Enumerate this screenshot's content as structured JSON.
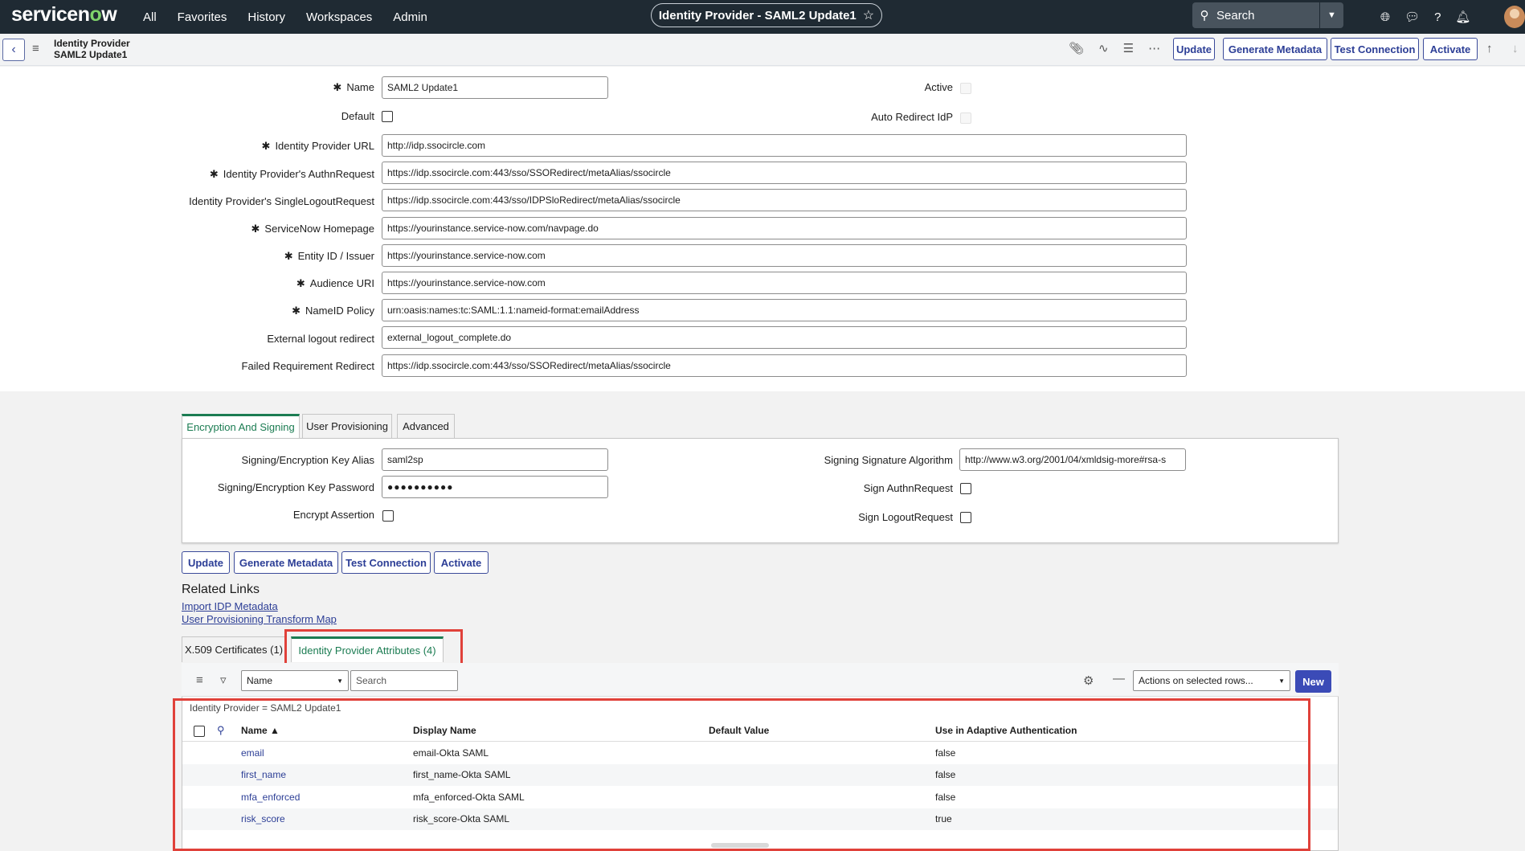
{
  "nav": {
    "logo": "servicenow",
    "links": [
      "All",
      "Favorites",
      "History",
      "Workspaces",
      "Admin"
    ],
    "context_title": "Identity Provider - SAML2 Update1",
    "search_placeholder": "Search"
  },
  "form_header": {
    "title_line1": "Identity Provider",
    "title_line2": "SAML2 Update1",
    "buttons": {
      "update": "Update",
      "generate_metadata": "Generate Metadata",
      "test_connection": "Test Connection",
      "activate": "Activate"
    }
  },
  "fields": {
    "name": {
      "label": "Name",
      "value": "SAML2 Update1"
    },
    "default": {
      "label": "Default"
    },
    "active": {
      "label": "Active"
    },
    "auto_redirect": {
      "label": "Auto Redirect IdP"
    },
    "idp_url": {
      "label": "Identity Provider URL",
      "value": "http://idp.ssocircle.com"
    },
    "authn_request": {
      "label": "Identity Provider's AuthnRequest",
      "value": "https://idp.ssocircle.com:443/sso/SSORedirect/metaAlias/ssocircle"
    },
    "single_logout": {
      "label": "Identity Provider's SingleLogoutRequest",
      "value": "https://idp.ssocircle.com:443/sso/IDPSloRedirect/metaAlias/ssocircle"
    },
    "homepage": {
      "label": "ServiceNow Homepage",
      "value": "https://yourinstance.service-now.com/navpage.do"
    },
    "entity_id": {
      "label": "Entity ID / Issuer",
      "value": "https://yourinstance.service-now.com"
    },
    "audience_uri": {
      "label": "Audience URI",
      "value": "https://yourinstance.service-now.com"
    },
    "nameid_policy": {
      "label": "NameID Policy",
      "value": "urn:oasis:names:tc:SAML:1.1:nameid-format:emailAddress"
    },
    "external_logout": {
      "label": "External logout redirect",
      "value": "external_logout_complete.do"
    },
    "failed_redirect": {
      "label": "Failed Requirement Redirect",
      "value": "https://idp.ssocircle.com:443/sso/SSORedirect/metaAlias/ssocircle"
    }
  },
  "tabs": {
    "items": [
      "Encryption And Signing",
      "User Provisioning",
      "Advanced"
    ],
    "encryption": {
      "key_alias": {
        "label": "Signing/Encryption Key Alias",
        "value": "saml2sp"
      },
      "key_password": {
        "label": "Signing/Encryption Key Password",
        "value": "●●●●●●●●●●"
      },
      "encrypt_assertion": {
        "label": "Encrypt Assertion"
      },
      "signature_algorithm": {
        "label": "Signing Signature Algorithm",
        "value": "http://www.w3.org/2001/04/xmldsig-more#rsa-s"
      },
      "sign_authn": {
        "label": "Sign AuthnRequest"
      },
      "sign_logout": {
        "label": "Sign LogoutRequest"
      }
    }
  },
  "bottom_buttons": {
    "update": "Update",
    "generate_metadata": "Generate Metadata",
    "test_connection": "Test Connection",
    "activate": "Activate"
  },
  "related_links": {
    "title": "Related Links",
    "links": [
      "Import IDP Metadata",
      "User Provisioning Transform Map"
    ]
  },
  "related_lists": {
    "tabs": [
      "X.509 Certificates (1)",
      "Identity Provider Attributes (4)"
    ],
    "toolbar": {
      "field_select": "Name",
      "search_placeholder": "Search",
      "actions": "Actions on selected rows...",
      "new": "New"
    },
    "filter_breadcrumb": "Identity Provider = SAML2 Update1",
    "columns": [
      "Name ▲",
      "Display Name",
      "Default Value",
      "Use in Adaptive Authentication"
    ],
    "rows": [
      {
        "name": "email",
        "display_name": "email-Okta SAML",
        "default_value": "",
        "adaptive": "false"
      },
      {
        "name": "first_name",
        "display_name": "first_name-Okta SAML",
        "default_value": "",
        "adaptive": "false"
      },
      {
        "name": "mfa_enforced",
        "display_name": "mfa_enforced-Okta SAML",
        "default_value": "",
        "adaptive": "false"
      },
      {
        "name": "risk_score",
        "display_name": "risk_score-Okta SAML",
        "default_value": "",
        "adaptive": "true"
      }
    ]
  },
  "colors": {
    "nav_bg": "#1f2a33",
    "accent_green": "#1b7c52",
    "button_blue": "#2c3e96",
    "highlight_red": "#e0413a"
  }
}
